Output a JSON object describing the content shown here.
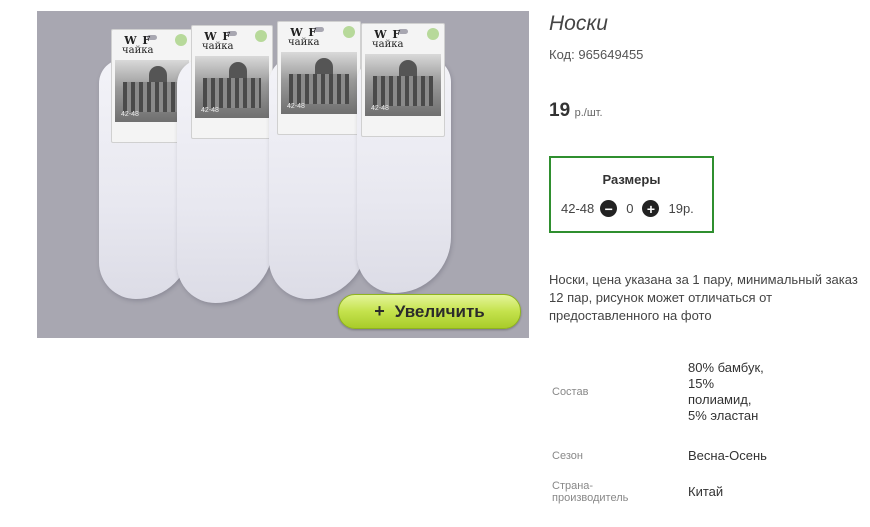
{
  "product": {
    "title": "Носки",
    "code_label": "Код:",
    "code_value": "965649455",
    "price_value": "19",
    "price_unit": "р./шт.",
    "zoom_button": {
      "icon": "+",
      "label": "Увеличить"
    },
    "image_pack": {
      "brand": "чайка",
      "brand_mark": "W F",
      "size_print": "42-48"
    }
  },
  "sizes": {
    "title": "Размеры",
    "rows": [
      {
        "size": "42-48",
        "quantity": "0",
        "price": "19р."
      }
    ]
  },
  "description": "Носки, цена указана за 1 пару, минимальный заказ 12 пар, рисунок может отличаться от предоставленного на фото",
  "properties": [
    {
      "label": "Состав",
      "value": "80% бамбук, 15% полиамид, 5% эластан"
    },
    {
      "label": "Сезон",
      "value": "Весна-Осень"
    },
    {
      "label": "Страна-производитель",
      "value": "Китай"
    }
  ],
  "colors": {
    "border_green": "#2f8f2f",
    "zoom_button_green": "#c4e24c",
    "photo_background": "#a8a7b1"
  }
}
